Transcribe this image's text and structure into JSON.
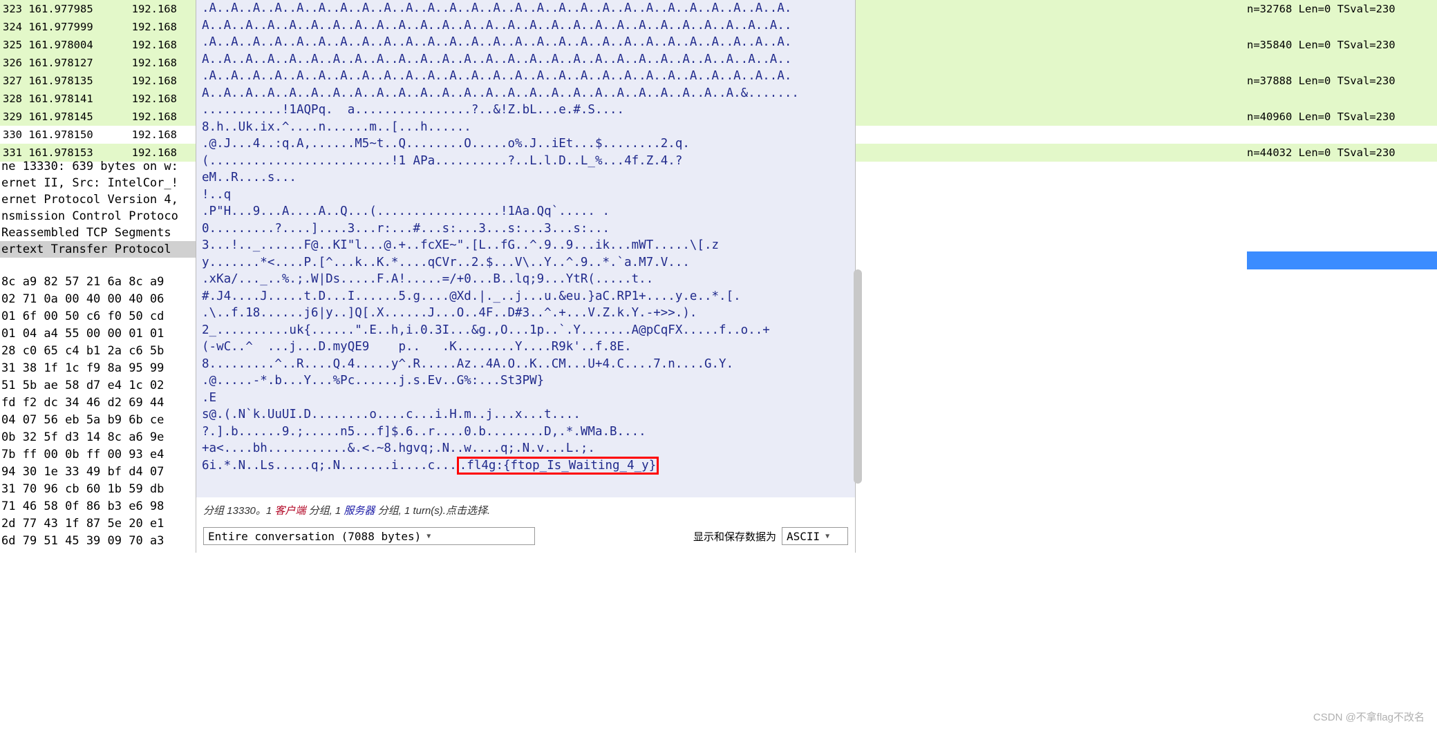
{
  "packets": [
    {
      "no": "323",
      "time": "161.977985",
      "src": "192.168",
      "cls": "green",
      "right": "n=32768 Len=0 TSval=230"
    },
    {
      "no": "324",
      "time": "161.977999",
      "src": "192.168",
      "cls": "green",
      "right": ""
    },
    {
      "no": "325",
      "time": "161.978004",
      "src": "192.168",
      "cls": "green",
      "right": "n=35840 Len=0 TSval=230"
    },
    {
      "no": "326",
      "time": "161.978127",
      "src": "192.168",
      "cls": "green",
      "right": ""
    },
    {
      "no": "327",
      "time": "161.978135",
      "src": "192.168",
      "cls": "green",
      "right": "n=37888 Len=0 TSval=230"
    },
    {
      "no": "328",
      "time": "161.978141",
      "src": "192.168",
      "cls": "green",
      "right": ""
    },
    {
      "no": "329",
      "time": "161.978145",
      "src": "192.168",
      "cls": "green",
      "right": "n=40960 Len=0 TSval=230"
    },
    {
      "no": "330",
      "time": "161.978150",
      "src": "192.168",
      "cls": "white",
      "right": ""
    },
    {
      "no": "331",
      "time": "161.978153",
      "src": "192.168",
      "cls": "green",
      "right": "n=44032 Len=0 TSval=230"
    }
  ],
  "frame_details": [
    "ne 13330: 639 bytes on w:",
    "ernet II, Src: IntelCor_!",
    "ernet Protocol Version 4,",
    "nsmission Control Protoco",
    "Reassembled TCP Segments ",
    "ertext Transfer Protocol "
  ],
  "hex_rows": [
    "8c a9 82 57 21 6a 8c a9",
    "02 71 0a 00 40 00 40 06",
    "01 6f 00 50 c6 f0 50 cd",
    "01 04 a4 55 00 00 01 01",
    "28 c0 65 c4 b1 2a c6 5b",
    "31 38 1f 1c f9 8a 95 99",
    "51 5b ae 58 d7 e4 1c 02",
    "fd f2 dc 34 46 d2 69 44",
    "04 07 56 eb 5a b9 6b ce",
    "0b 32 5f d3 14 8c a6 9e",
    "7b ff 00 0b ff 00 93 e4",
    "94 30 1e 33 49 bf d4 07",
    "31 70 96 cb 60 1b 59 db",
    "71 46 58 0f 86 b3 e6 98",
    "2d 77 43 1f 87 5e 20 e1",
    "6d 79 51 45 39 09 70 a3"
  ],
  "stream_lines": [
    ".A..A..A..A..A..A..A..A..A..A..A..A..A..A..A..A..A..A..A..A..A..A..A..A..A..A..A.",
    "A..A..A..A..A..A..A..A..A..A..A..A..A..A..A..A..A..A..A..A..A..A..A..A..A..A..A..",
    ".A..A..A..A..A..A..A..A..A..A..A..A..A..A..A..A..A..A..A..A..A..A..A..A..A..A..A.",
    "A..A..A..A..A..A..A..A..A..A..A..A..A..A..A..A..A..A..A..A..A..A..A..A..A..A..A..",
    ".A..A..A..A..A..A..A..A..A..A..A..A..A..A..A..A..A..A..A..A..A..A..A..A..A..A..A.",
    "A..A..A..A..A..A..A..A..A..A..A..A..A..A..A..A..A..A..A..A..A..A..A..A..A.&.......",
    "...........!1AQPq.  a................?..&!Z.bL...e.#.S....",
    "8.h..Uk.ix.^....n......m..[...h......",
    ".@.J...4..:q.A,......M5~t..Q........O.....o%.J..iEt...$........2.q.",
    "(.........................!1 APa..........?..L.l.D..L_%...4f.Z.4.?",
    "eM..R....s...",
    "!..q",
    ".P\"H...9...A....A..Q...(.................!1Aa.Qq`..... .",
    "0.........?....]....3...r:...#...s:...3...s:...3...s:...",
    "3...!.._......F@..KI\"l...@.+..fcXE~\".[L..fG..^.9..9...ik...mWT.....\\[.z",
    "y.......*<....P.[^...k..K.*....qCVr..2.$...V\\..Y..^.9..*.`a.M7.V...",
    ".xKa/..._..%.;.W|Ds.....F.A!.....=/+0...B..lq;9...YtR(.....t..",
    "#.J4....J.....t.D...I......5.g....@Xd.|._..j...u.&eu.}aC.RP1+....y.e..*.[.",
    ".\\..f.18......j6|y..]Q[.X......J...O..4F..D#3..^.+...V.Z.k.Y.-+>>.).",
    "2_..........uk{......\".E..h,i.0.3I...&g.,O...1p..`.Y.......A@pCqFX.....f..o..+",
    "(-wC..^  ...j...D.myQE9    p..   .K........Y....R9k'..f.8E.",
    "8.........^..R....Q.4.....y^.R.....Az..4A.O..K..CM...U+4.C....7.n....G.Y.",
    ".@.....-*.b...Y...%Pc......j.s.Ev..G%:...St3PW}",
    ".E",
    "s@.(.N`k.UuUI.D........o....c...i.H.m..j...x...t....",
    "?.].b......9.;.....n5...f]$.6..r....0.b........D,.*.WMa.B....",
    "+a<....bh...........&.<.~8.hgvq;.N..w....q;.N.v...L.;."
  ],
  "flag_line_prefix": "6i.*.N..Ls.....q;.N.......i....c...",
  "flag_text": ".fl4g:{ftop_Is_Waiting_4_y}",
  "footer": {
    "prefix": "分组 13330。1 ",
    "client": "客户端",
    "mid1": " 分组, 1 ",
    "server": "服务器",
    "suffix": " 分组, 1 turn(s).点击选择."
  },
  "bottom": {
    "conversation": "Entire conversation (7088 bytes)",
    "save_label": "显示和保存数据为",
    "encoding": "ASCII"
  },
  "watermark": "CSDN @不拿flag不改名"
}
